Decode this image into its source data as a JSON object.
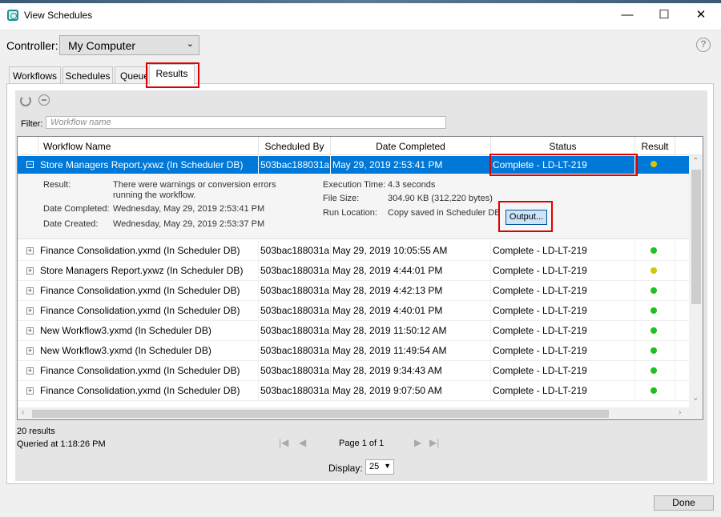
{
  "window": {
    "title": "View Schedules",
    "minimize": "—",
    "maximize": "☐",
    "close": "✕"
  },
  "controller": {
    "label": "Controller:",
    "value": "My Computer"
  },
  "tabs": [
    {
      "label": "Workflows"
    },
    {
      "label": "Schedules"
    },
    {
      "label": "Queue"
    },
    {
      "label": "Results"
    }
  ],
  "filter": {
    "label": "Filter:",
    "placeholder": "Workflow name"
  },
  "columns": [
    "Workflow Name",
    "Scheduled By",
    "Date Completed",
    "Status",
    "Result"
  ],
  "selected": {
    "name": "Store Managers Report.yxwz (In Scheduler DB)",
    "by": "503bac188031a",
    "date": "May 29, 2019 2:53:41 PM",
    "status": "Complete - LD-LT-219",
    "result_color": "#d4c600"
  },
  "detail": {
    "result_label": "Result:",
    "result_value_1": "There were warnings or conversion errors",
    "result_value_2": "running the workflow.",
    "date_completed_label": "Date Completed:",
    "date_completed_value": "Wednesday, May 29, 2019 2:53:41 PM",
    "date_created_label": "Date Created:",
    "date_created_value": "Wednesday, May 29, 2019 2:53:37 PM",
    "exec_label": "Execution Time:",
    "exec_value": "4.3 seconds",
    "size_label": "File Size:",
    "size_value": "304.90 KB (312,220 bytes)",
    "loc_label": "Run Location:",
    "loc_value": "Copy saved in Scheduler DB",
    "output_button": "Output..."
  },
  "rows": [
    {
      "name": "Finance Consolidation.yxmd (In Scheduler DB)",
      "by": "503bac188031a",
      "date": "May 29, 2019 10:05:55 AM",
      "status": "Complete - LD-LT-219",
      "result": "green"
    },
    {
      "name": "Store Managers Report.yxwz (In Scheduler DB)",
      "by": "503bac188031a",
      "date": "May 28, 2019 4:44:01 PM",
      "status": "Complete - LD-LT-219",
      "result": "yellow"
    },
    {
      "name": "Finance Consolidation.yxmd (In Scheduler DB)",
      "by": "503bac188031a",
      "date": "May 28, 2019 4:42:13 PM",
      "status": "Complete - LD-LT-219",
      "result": "green"
    },
    {
      "name": "Finance Consolidation.yxmd (In Scheduler DB)",
      "by": "503bac188031a",
      "date": "May 28, 2019 4:40:01 PM",
      "status": "Complete - LD-LT-219",
      "result": "green"
    },
    {
      "name": "New Workflow3.yxmd (In Scheduler DB)",
      "by": "503bac188031a",
      "date": "May 28, 2019 11:50:12 AM",
      "status": "Complete - LD-LT-219",
      "result": "green"
    },
    {
      "name": "New Workflow3.yxmd (In Scheduler DB)",
      "by": "503bac188031a",
      "date": "May 28, 2019 11:49:54 AM",
      "status": "Complete - LD-LT-219",
      "result": "green"
    },
    {
      "name": "Finance Consolidation.yxmd (In Scheduler DB)",
      "by": "503bac188031a",
      "date": "May 28, 2019 9:34:43 AM",
      "status": "Complete - LD-LT-219",
      "result": "green"
    },
    {
      "name": "Finance Consolidation.yxmd (In Scheduler DB)",
      "by": "503bac188031a",
      "date": "May 28, 2019 9:07:50 AM",
      "status": "Complete - LD-LT-219",
      "result": "green"
    }
  ],
  "result_colors": {
    "green": "#1ec21e",
    "yellow": "#d4c600"
  },
  "footer": {
    "count": "20 results",
    "queried": "Queried at 1:18:26 PM",
    "page": "Page 1 of 1",
    "display_label": "Display:",
    "display_value": "25",
    "done": "Done"
  },
  "icons": {
    "refresh": "refresh-icon",
    "stop": "stop-icon",
    "help": "help-icon"
  }
}
